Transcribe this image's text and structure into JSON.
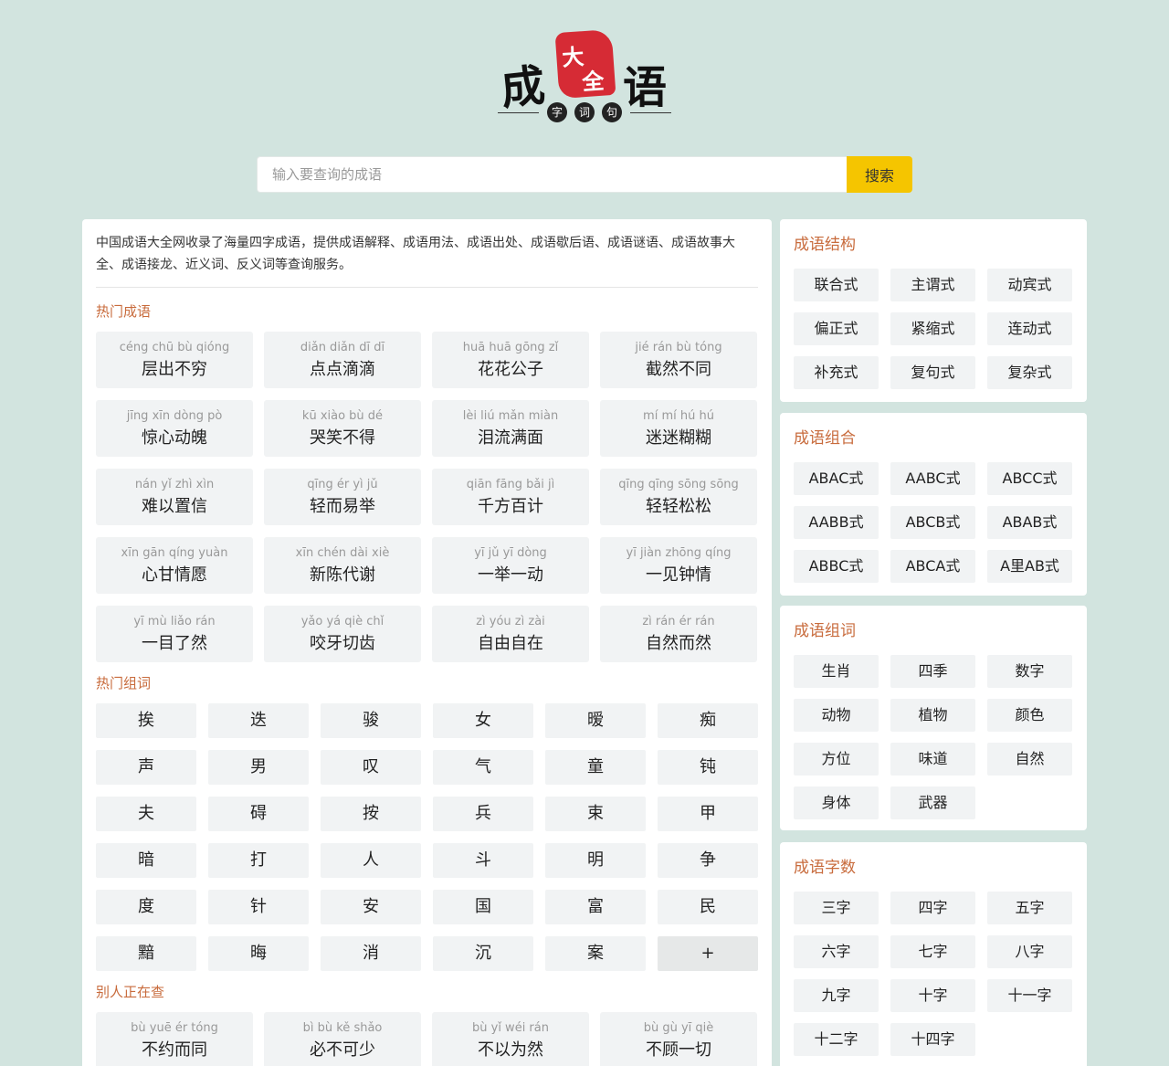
{
  "logo": {
    "char1": "成",
    "char2": "语",
    "seal1": "大",
    "seal2": "全",
    "sub": [
      "字",
      "词",
      "句"
    ]
  },
  "search": {
    "placeholder": "输入要查询的成语",
    "button": "搜索"
  },
  "intro": "中国成语大全网收录了海量四字成语，提供成语解释、成语用法、成语出处、成语歇后语、成语谜语、成语故事大全、成语接龙、近义词、反义词等查询服务。",
  "hot_idioms": {
    "title": "热门成语",
    "items": [
      {
        "py": "céng chū bù qióng",
        "zh": "层出不穷"
      },
      {
        "py": "diǎn diǎn dī dī",
        "zh": "点点滴滴"
      },
      {
        "py": "huā huā gōng zǐ",
        "zh": "花花公子"
      },
      {
        "py": "jié rán bù tóng",
        "zh": "截然不同"
      },
      {
        "py": "jīng xīn dòng pò",
        "zh": "惊心动魄"
      },
      {
        "py": "kū xiào bù dé",
        "zh": "哭笑不得"
      },
      {
        "py": "lèi liú mǎn miàn",
        "zh": "泪流满面"
      },
      {
        "py": "mí mí hú hú",
        "zh": "迷迷糊糊"
      },
      {
        "py": "nán yǐ zhì xìn",
        "zh": "难以置信"
      },
      {
        "py": "qīng ér yì jǔ",
        "zh": "轻而易举"
      },
      {
        "py": "qiān fāng bǎi jì",
        "zh": "千方百计"
      },
      {
        "py": "qīng qīng sōng sōng",
        "zh": "轻轻松松"
      },
      {
        "py": "xīn gān qíng yuàn",
        "zh": "心甘情愿"
      },
      {
        "py": "xīn chén dài xiè",
        "zh": "新陈代谢"
      },
      {
        "py": "yī jǔ yī dòng",
        "zh": "一举一动"
      },
      {
        "py": "yī jiàn zhōng qíng",
        "zh": "一见钟情"
      },
      {
        "py": "yī mù liǎo rán",
        "zh": "一目了然"
      },
      {
        "py": "yǎo yá qiè chǐ",
        "zh": "咬牙切齿"
      },
      {
        "py": "zì yóu zì zài",
        "zh": "自由自在"
      },
      {
        "py": "zì rán ér rán",
        "zh": "自然而然"
      }
    ]
  },
  "hot_words": {
    "title": "热门组词",
    "items": [
      "挨",
      "迭",
      "骏",
      "女",
      "暧",
      "痴",
      "声",
      "男",
      "叹",
      "气",
      "童",
      "钝",
      "夫",
      "碍",
      "按",
      "兵",
      "束",
      "甲",
      "暗",
      "打",
      "人",
      "斗",
      "明",
      "争",
      "度",
      "针",
      "安",
      "国",
      "富",
      "民",
      "黯",
      "晦",
      "消",
      "沉",
      "案"
    ],
    "more": "+"
  },
  "others": {
    "title": "别人正在查",
    "items": [
      {
        "py": "bù yuē ér tóng",
        "zh": "不约而同"
      },
      {
        "py": "bì bù kě shǎo",
        "zh": "必不可少"
      },
      {
        "py": "bù yǐ wéi rán",
        "zh": "不以为然"
      },
      {
        "py": "bù gù yī qiè",
        "zh": "不顾一切"
      }
    ]
  },
  "sidebar": {
    "structure": {
      "title": "成语结构",
      "items": [
        "联合式",
        "主谓式",
        "动宾式",
        "偏正式",
        "紧缩式",
        "连动式",
        "补充式",
        "复句式",
        "复杂式"
      ]
    },
    "combination": {
      "title": "成语组合",
      "items": [
        "ABAC式",
        "AABC式",
        "ABCC式",
        "AABB式",
        "ABCB式",
        "ABAB式",
        "ABBC式",
        "ABCA式",
        "A里AB式"
      ]
    },
    "words": {
      "title": "成语组词",
      "items": [
        "生肖",
        "四季",
        "数字",
        "动物",
        "植物",
        "颜色",
        "方位",
        "味道",
        "自然",
        "身体",
        "武器"
      ]
    },
    "count": {
      "title": "成语字数",
      "items": [
        "三字",
        "四字",
        "五字",
        "六字",
        "七字",
        "八字",
        "九字",
        "十字",
        "十一字",
        "十二字",
        "十四字"
      ]
    }
  }
}
